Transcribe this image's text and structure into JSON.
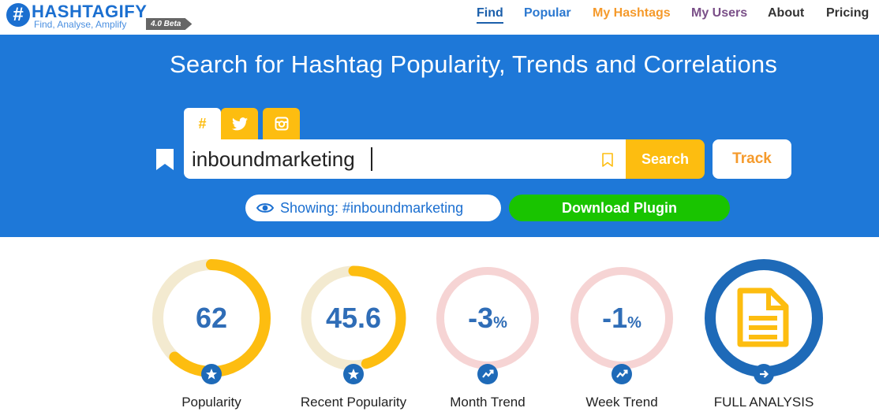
{
  "brand": {
    "logo_mark": "#",
    "name": "HASHTAGIFY",
    "tagline": "Find, Analyse, Amplify",
    "version_badge": "4.0 Beta"
  },
  "nav": {
    "items": [
      {
        "label": "Find",
        "color": "#1b5fab",
        "active": true
      },
      {
        "label": "Popular",
        "color": "#2b78d0"
      },
      {
        "label": "My Hashtags",
        "color": "#f59a2b"
      },
      {
        "label": "My Users",
        "color": "#7a4f88"
      },
      {
        "label": "About",
        "color": "#333333"
      },
      {
        "label": "Pricing",
        "color": "#333333"
      }
    ]
  },
  "hero": {
    "title": "Search for Hashtag Popularity, Trends and Correlations",
    "background": "#1e78d8",
    "tabs": [
      {
        "icon": "hashtag-icon",
        "glyph": "#",
        "active": true
      },
      {
        "icon": "twitter-icon",
        "active": false
      },
      {
        "icon": "instagram-icon",
        "active": false
      }
    ],
    "search": {
      "value": "inboundmarketing",
      "button_label": "Search",
      "track_label": "Track"
    },
    "showing": "Showing: #inboundmarketing",
    "plugin_label": "Download Plugin"
  },
  "metrics": [
    {
      "label": "Popularity",
      "value": "62",
      "suffix": "",
      "fill_fraction": 0.62,
      "ring_color": "#fdbd10",
      "track_color": "#f3ead0",
      "badge_icon": "star-icon"
    },
    {
      "label": "Recent Popularity",
      "value": "45.6",
      "suffix": "",
      "fill_fraction": 0.456,
      "ring_color": "#fdbd10",
      "track_color": "#f3ead0",
      "badge_icon": "star-icon"
    },
    {
      "label": "Month Trend",
      "value": "-3",
      "suffix": "%",
      "fill_fraction": 0,
      "ring_color": "#f4c7c7",
      "track_color": "#f6d4d4",
      "badge_icon": "trend-icon"
    },
    {
      "label": "Week Trend",
      "value": "-1",
      "suffix": "%",
      "fill_fraction": 0,
      "ring_color": "#f4c7c7",
      "track_color": "#f6d4d4",
      "badge_icon": "trend-icon"
    },
    {
      "label": "FULL ANALYSIS",
      "value": "",
      "suffix": "",
      "fill_fraction": 1,
      "ring_color": "#1e6ab8",
      "track_color": "#1e6ab8",
      "badge_icon": "arrow-right-icon"
    }
  ]
}
